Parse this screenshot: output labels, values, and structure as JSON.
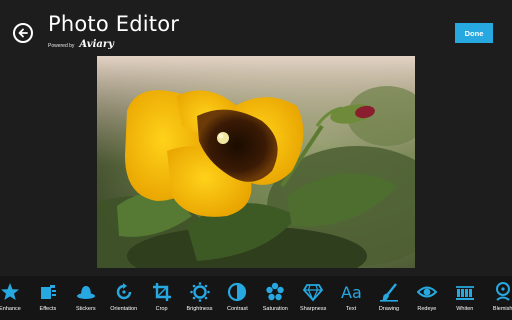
{
  "header": {
    "title": "Photo Editor",
    "powered_by": "Powered by",
    "brand": "Aviary",
    "back_icon": "back-arrow-icon",
    "done_label": "Done"
  },
  "colors": {
    "background": "#1d1d1d",
    "toolbar": "#151515",
    "accent": "#27a8e0",
    "icon": "#27a8e0"
  },
  "canvas": {
    "subject": "yellow pansy photo"
  },
  "toolbar": {
    "tools": [
      {
        "label": "Enhance",
        "icon": "star-icon"
      },
      {
        "label": "Effects",
        "icon": "effects-icon"
      },
      {
        "label": "Stickers",
        "icon": "hat-icon"
      },
      {
        "label": "Orientation",
        "icon": "rotate-icon"
      },
      {
        "label": "Crop",
        "icon": "crop-icon"
      },
      {
        "label": "Brightness",
        "icon": "sun-icon"
      },
      {
        "label": "Contrast",
        "icon": "contrast-icon"
      },
      {
        "label": "Saturation",
        "icon": "saturation-icon"
      },
      {
        "label": "Sharpness",
        "icon": "diamond-icon"
      },
      {
        "label": "Text",
        "icon": "text-icon"
      },
      {
        "label": "Drawing",
        "icon": "brush-icon"
      },
      {
        "label": "Redeye",
        "icon": "eye-icon"
      },
      {
        "label": "Whiten",
        "icon": "teeth-icon"
      },
      {
        "label": "Blemish",
        "icon": "blemish-icon"
      }
    ]
  }
}
